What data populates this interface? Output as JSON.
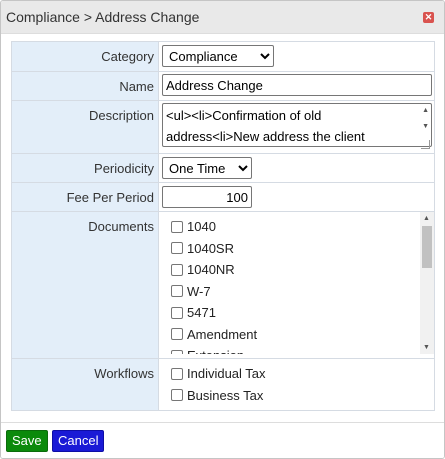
{
  "window": {
    "title": "Compliance > Address Change",
    "close_icon": "close-icon"
  },
  "form": {
    "category": {
      "label": "Category",
      "value": "Compliance",
      "options": [
        "Compliance"
      ]
    },
    "name": {
      "label": "Name",
      "value": "Address Change"
    },
    "description": {
      "label": "Description",
      "value": "<ul><li>Confirmation of old address<li>New address the client"
    },
    "periodicity": {
      "label": "Periodicity",
      "value": "One Time",
      "options": [
        "One Time"
      ]
    },
    "fee_per_period": {
      "label": "Fee Per Period",
      "value": "100"
    },
    "documents": {
      "label": "Documents",
      "items": [
        "1040",
        "1040SR",
        "1040NR",
        "W-7",
        "5471",
        "Amendment",
        "Extension"
      ]
    },
    "workflows": {
      "label": "Workflows",
      "items": [
        "Individual Tax",
        "Business Tax"
      ]
    }
  },
  "footer": {
    "save_label": "Save",
    "cancel_label": "Cancel"
  },
  "colors": {
    "label_bg": "#e3eef9",
    "save_bg": "#0b8a0b",
    "cancel_bg": "#1a1ad6",
    "close_bg": "#d9534f"
  }
}
